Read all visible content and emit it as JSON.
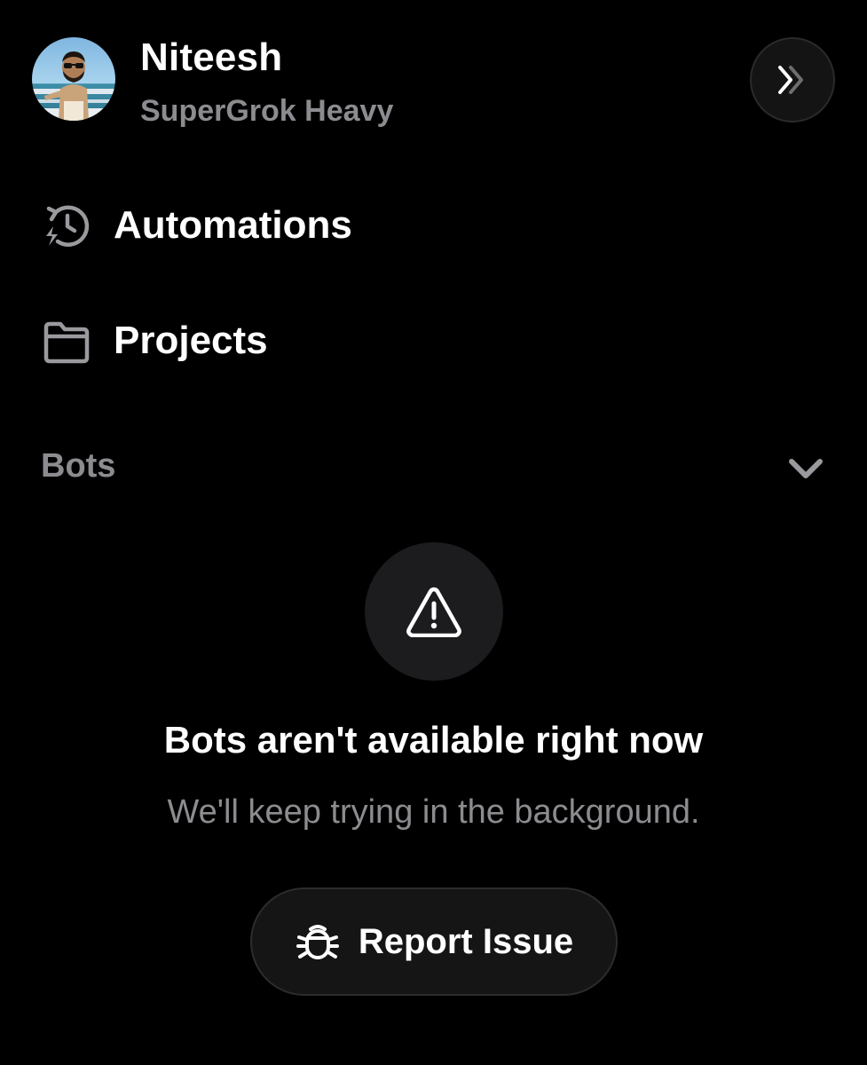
{
  "user": {
    "name": "Niteesh",
    "plan": "SuperGrok Heavy",
    "avatar_icon": "memoji-avatar"
  },
  "header": {
    "expand_icon": "double-chevron-right-icon"
  },
  "nav": {
    "items": [
      {
        "label": "Automations",
        "icon": "history-bolt-icon"
      },
      {
        "label": "Projects",
        "icon": "folder-icon"
      }
    ]
  },
  "bots_section": {
    "title": "Bots",
    "chevron_icon": "chevron-down-icon",
    "empty_state": {
      "icon": "warning-triangle-icon",
      "title": "Bots aren't available right now",
      "subtitle": "We'll keep trying in the background.",
      "report_button_label": "Report Issue",
      "report_button_icon": "bug-icon"
    }
  },
  "colors": {
    "background": "#000000",
    "primary_text": "#ffffff",
    "secondary_text": "#8c8c90",
    "surface": "#1c1c1e",
    "button_surface": "#151515",
    "border": "#2c2c2c"
  }
}
